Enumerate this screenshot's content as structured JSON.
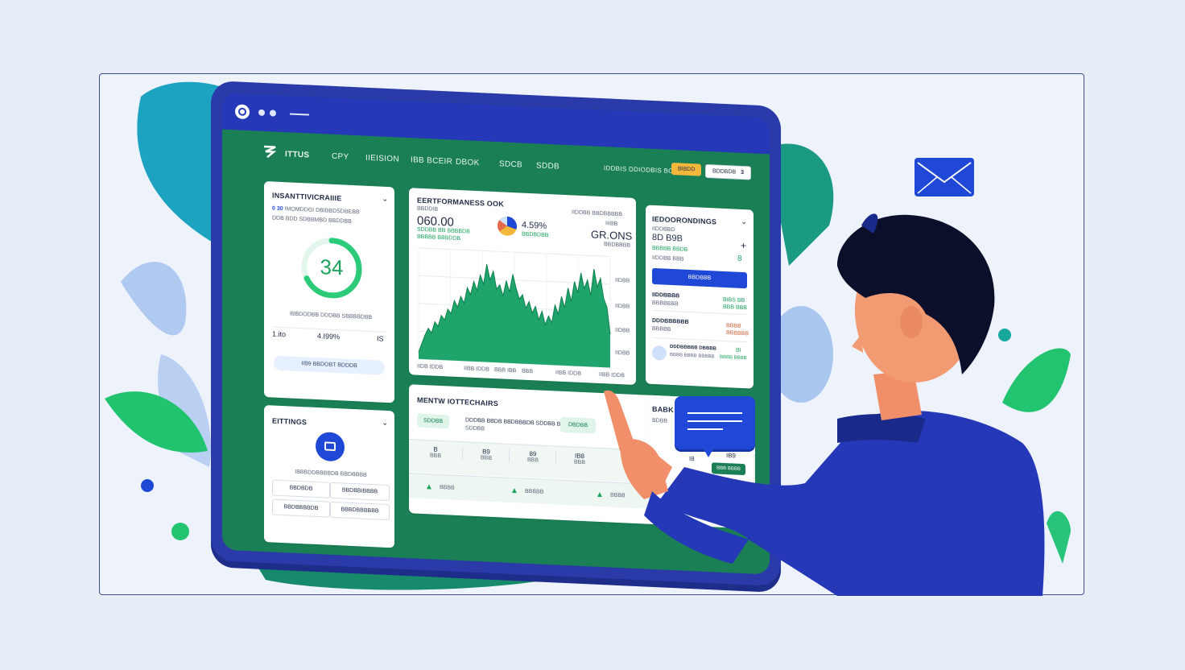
{
  "nav": {
    "brand": "ITTUS",
    "items": [
      "CPY",
      "IIEISION",
      "IBB BCEIR",
      "DBOK",
      "SDCB",
      "SDDB"
    ],
    "right_label": "IDDBIS DDIODBIS BOBIS",
    "yellow_button": "BIBDD",
    "outline_button": "BDDBDB",
    "outline_badge": "3"
  },
  "insights_card": {
    "title": "INSANTTIVICRAIIIE",
    "line1_prefix": "0 30",
    "line1": "IMOMDDGI DBIBBDSDBEBB",
    "line2": "DDB BDD SDBBMBD BBDDBB",
    "gauge_value": "34",
    "gauge_fraction": 0.68,
    "caption": "IBBDODBB DDDBB SBBBBDBB",
    "stat_left": "1.ito",
    "stat_mid": "4.I99%",
    "stat_right": "IS",
    "button": "IIB9 BBDOBT BDDDB"
  },
  "settings_card": {
    "title": "EITTINGS",
    "caption": "IBBBDDBBBBDB BBDBBBB",
    "left_buttons": [
      "BBDBDB",
      "BBDBBBBDB"
    ],
    "right_buttons": [
      "BBDBBIBBBB",
      "BBBDBBBBBB"
    ]
  },
  "performance_card": {
    "title": "EERTFORMANESS OOK",
    "subtitle": "BBDDIB",
    "big_value": "060.00",
    "big_sub1": "SDDBB BB BBBBDB",
    "big_sub2": "BBBBB BBBDDB",
    "percent": "4.59%",
    "percent_sub": "BBDBDBB",
    "right_caption": "IIDDBB BBDBBBBB",
    "right_caption2": "IIIBB",
    "right_value": "GR.ONS",
    "right_sub": "BBDBBBB",
    "y_labels": [
      "IIDBB",
      "IIDBB",
      "IIDBB",
      "IIDBB"
    ],
    "x_labels": [
      "IIDB IDDB",
      "IIBB IDDB",
      "BBB IBB",
      "BBB",
      "IIBB IDDB",
      "IIBB IDDB"
    ]
  },
  "chart_data": {
    "type": "area",
    "title": "EERTFORMANESS OOK",
    "xlabel": "",
    "ylabel": "",
    "grid": true,
    "ylim": [
      0,
      100
    ],
    "x": [
      0,
      1,
      2,
      3,
      4,
      5,
      6,
      7,
      8,
      9,
      10,
      11,
      12,
      13,
      14,
      15,
      16,
      17,
      18,
      19,
      20,
      21,
      22,
      23,
      24,
      25,
      26,
      27,
      28,
      29,
      30,
      31,
      32,
      33,
      34,
      35,
      36,
      37,
      38,
      39,
      40,
      41,
      42,
      43,
      44,
      45,
      46,
      47,
      48,
      49,
      50,
      51,
      52,
      53,
      54,
      55,
      56,
      57,
      58,
      59
    ],
    "series": [
      {
        "values": [
          6,
          14,
          22,
          28,
          24,
          34,
          30,
          40,
          36,
          46,
          42,
          54,
          48,
          58,
          52,
          66,
          60,
          72,
          64,
          78,
          70,
          88,
          74,
          82,
          66,
          70,
          60,
          74,
          64,
          80,
          68,
          58,
          62,
          50,
          56,
          46,
          52,
          40,
          48,
          36,
          44,
          38,
          54,
          46,
          62,
          52,
          70,
          58,
          76,
          66,
          84,
          70,
          78,
          64,
          88,
          72,
          80,
          62,
          54,
          30
        ]
      }
    ]
  },
  "news_card": {
    "title": "MENTW IOTTECHAIRS",
    "tag1": "SDDBB",
    "tag2": "DBDBB",
    "headline": "DDDBB BBDB BBDBBBDB SDDBB BDB",
    "headline_sub": "SDDBB",
    "table_top": [
      "B",
      "B9",
      "89",
      "IB8"
    ],
    "table_sub": [
      "BBB",
      "BBB",
      "BBB",
      "BBB"
    ],
    "row2": [
      "BBBB",
      "BBBBB",
      "BBBB"
    ]
  },
  "side_card": {
    "title": "IEDOORONDINGS",
    "line1": "IIDDBBD",
    "value": "8D B9B",
    "line2": "BBBBB BBDB",
    "line3": "IIDDBB BBB",
    "plus": "+",
    "counter": "8",
    "button": "BBDBBB",
    "item1_title": "IIDDBBBB",
    "item1_sub": "BBBBBBB",
    "item1_val": "BIBS BB",
    "item1_val2": "BBB BBB",
    "item2_title": "DDDBBBBBB",
    "item2_sub": "BBBBB",
    "item2_val": "BBBB",
    "item2_val2": "BBBBBB",
    "item3_title": "DDDBBBBB DBBBB",
    "item3_sub": "BBBB BBBB BBBBB",
    "item3_val": "BI",
    "item3_val2": "BBBB BBBB"
  },
  "small_card": {
    "title": "BABK",
    "sub": "BDBB",
    "value": "I8",
    "value2": "IB9",
    "button": "BBB BBBB"
  },
  "colors": {
    "monitor": "#2a3aa8",
    "green": "#1b7f55",
    "accent_blue": "#1f48d6",
    "chart_fill": "#1fa56c",
    "gauge": "#2ccb7a"
  }
}
